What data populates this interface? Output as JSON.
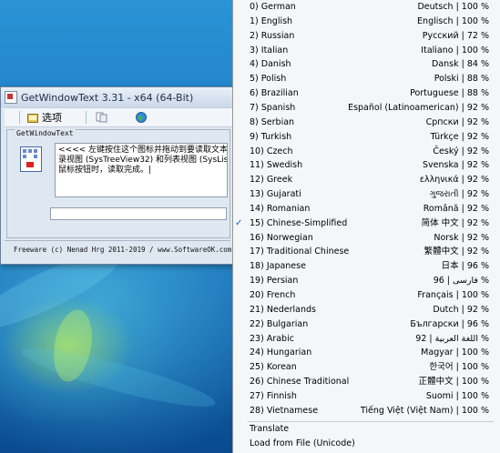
{
  "window": {
    "title": "GetWindowText 3.31 - x64 (64-Bit)",
    "toolbar": {
      "options_label": "选项"
    },
    "group_title": "GetWindowText",
    "text_lines": [
      "<<<< 左键按住这个图标并拖动到要读取文本的窗口",
      "录视图 (SysTreeView32) 和列表视图 (SysListVi",
      "鼠标按钮时，读取完成。|"
    ],
    "small_input_value": "",
    "footer": "Freeware (c) Nenad Hrg 2011-2019 / www.SoftwareOK.com"
  },
  "menu": {
    "languages": [
      {
        "label": "0) German",
        "right": "Deutsch | 100 %",
        "checked": false
      },
      {
        "label": "1) English",
        "right": "Englisch | 100 %",
        "checked": false
      },
      {
        "label": "2) Russian",
        "right": "Русский | 72 %",
        "checked": false
      },
      {
        "label": "3) Italian",
        "right": "Italiano | 100 %",
        "checked": false
      },
      {
        "label": "4) Danish",
        "right": "Dansk | 84 %",
        "checked": false
      },
      {
        "label": "5) Polish",
        "right": "Polski | 88 %",
        "checked": false
      },
      {
        "label": "6) Brazilian",
        "right": "Portuguese | 88 %",
        "checked": false
      },
      {
        "label": "7) Spanish",
        "right": "Español (Latinoamerican) | 92 %",
        "checked": false
      },
      {
        "label": "8) Serbian",
        "right": "Српски | 92 %",
        "checked": false
      },
      {
        "label": "9) Turkish",
        "right": "Türkçe | 92 %",
        "checked": false
      },
      {
        "label": "10) Czech",
        "right": "Český | 92 %",
        "checked": false
      },
      {
        "label": "11) Swedish",
        "right": "Svenska | 92 %",
        "checked": false
      },
      {
        "label": "12) Greek",
        "right": "ελληνικά | 92 %",
        "checked": false
      },
      {
        "label": "13) Gujarati",
        "right": "ગુજરાતી | 92 %",
        "checked": false
      },
      {
        "label": "14) Romanian",
        "right": "Română | 92 %",
        "checked": false
      },
      {
        "label": "15) Chinese-Simplified",
        "right": "简体 中文 | 92 %",
        "checked": true
      },
      {
        "label": "16) Norwegian",
        "right": "Norsk | 92 %",
        "checked": false
      },
      {
        "label": "17) Traditional Chinese",
        "right": "繁體中文 | 92 %",
        "checked": false
      },
      {
        "label": "18) Japanese",
        "right": "日本 | 96 %",
        "checked": false
      },
      {
        "label": "19) Persian",
        "right": "96 | فارسی %",
        "checked": false
      },
      {
        "label": "20) French",
        "right": "Français | 100 %",
        "checked": false
      },
      {
        "label": "21) Nederlands",
        "right": "Dutch | 92 %",
        "checked": false
      },
      {
        "label": "22) Bulgarian",
        "right": "Български | 96 %",
        "checked": false
      },
      {
        "label": "23) Arabic",
        "right": "اللغة العربية | 92 %",
        "checked": false
      },
      {
        "label": "24) Hungarian",
        "right": "Magyar | 100 %",
        "checked": false
      },
      {
        "label": "25) Korean",
        "right": "한국어 | 100 %",
        "checked": false
      },
      {
        "label": "26) Chinese Traditional",
        "right": "正體中文 | 100 %",
        "checked": false
      },
      {
        "label": "27) Finnish",
        "right": "Suomi | 100 %",
        "checked": false
      },
      {
        "label": "28) Vietnamese",
        "right": "Tiếng Việt (Việt Nam) | 100 %",
        "checked": false
      }
    ],
    "translate_label": "Translate",
    "load_label": "Load from File (Unicode)",
    "check_glyph": "✓"
  }
}
